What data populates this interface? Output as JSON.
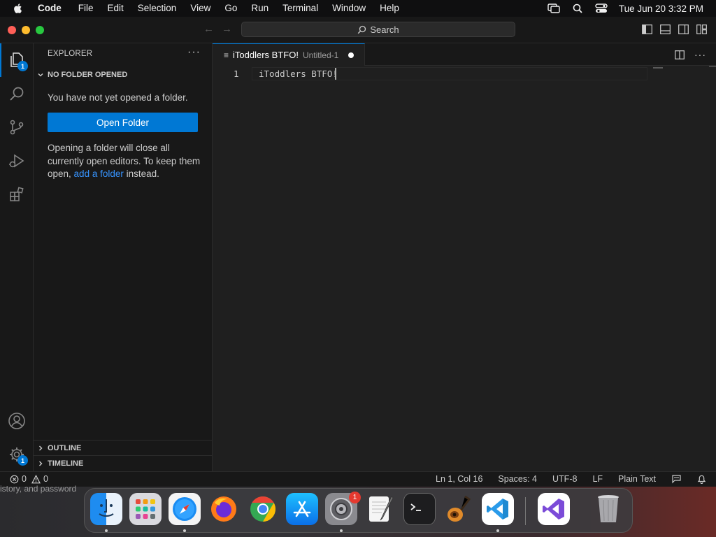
{
  "menubar": {
    "app_name": "Code",
    "items": [
      "File",
      "Edit",
      "Selection",
      "View",
      "Go",
      "Run",
      "Terminal",
      "Window",
      "Help"
    ],
    "clock": "Tue Jun 20  3:32 PM"
  },
  "titlebar": {
    "search_label": "Search"
  },
  "activity_bar": {
    "explorer_badge": "1",
    "settings_badge": "1"
  },
  "sidebar": {
    "title": "EXPLORER",
    "more": "···",
    "section_title": "NO FOLDER OPENED",
    "no_folder_message": "You have not yet opened a folder.",
    "open_folder_label": "Open Folder",
    "note_prefix": "Opening a folder will close all currently open editors. To keep them open, ",
    "note_link": "add a folder",
    "note_suffix": " instead.",
    "outline_label": "OUTLINE",
    "timeline_label": "TIMELINE"
  },
  "editor": {
    "tab_title": "iToddlers BTFO!",
    "tab_description": "Untitled-1",
    "line_number": "1",
    "line_text": "iToddlers BTFO!"
  },
  "statusbar": {
    "errors": "0",
    "warnings": "0",
    "cursor_position": "Ln 1, Col 16",
    "indentation": "Spaces: 4",
    "encoding": "UTF-8",
    "eol": "LF",
    "language": "Plain Text"
  },
  "desktop": {
    "background_text": "istory, and password"
  },
  "dock": {
    "settings_badge": "1"
  },
  "colors": {
    "accent": "#0078d4",
    "link": "#3794ff",
    "close": "#ff5f57",
    "minimize": "#febc2e",
    "zoom": "#28c840"
  }
}
